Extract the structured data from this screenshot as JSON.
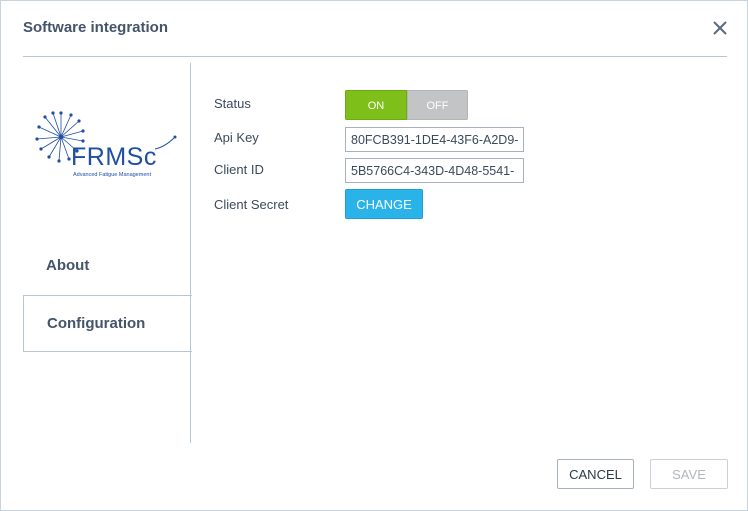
{
  "dialog": {
    "title": "Software integration",
    "close_icon": "close-icon"
  },
  "sidebar": {
    "logo": {
      "text": "FRMSc",
      "tagline": "Advanced Fatigue Management"
    },
    "items": [
      {
        "label": "About",
        "selected": false
      },
      {
        "label": "Configuration",
        "selected": true
      }
    ]
  },
  "form": {
    "status": {
      "label": "Status",
      "on_label": "ON",
      "off_label": "OFF",
      "value": "ON"
    },
    "api_key": {
      "label": "Api Key",
      "value": "80FCB391-1DE4-43F6-A2D9-"
    },
    "client_id": {
      "label": "Client ID",
      "value": "5B5766C4-343D-4D48-5541-"
    },
    "client_secret": {
      "label": "Client Secret",
      "button_label": "CHANGE"
    }
  },
  "footer": {
    "cancel_label": "CANCEL",
    "save_label": "SAVE"
  },
  "colors": {
    "toggle_on": "#7ebf1a",
    "toggle_off": "#c2c4c6",
    "change_button": "#29b3e8",
    "logo_blue": "#1e4fa3"
  }
}
